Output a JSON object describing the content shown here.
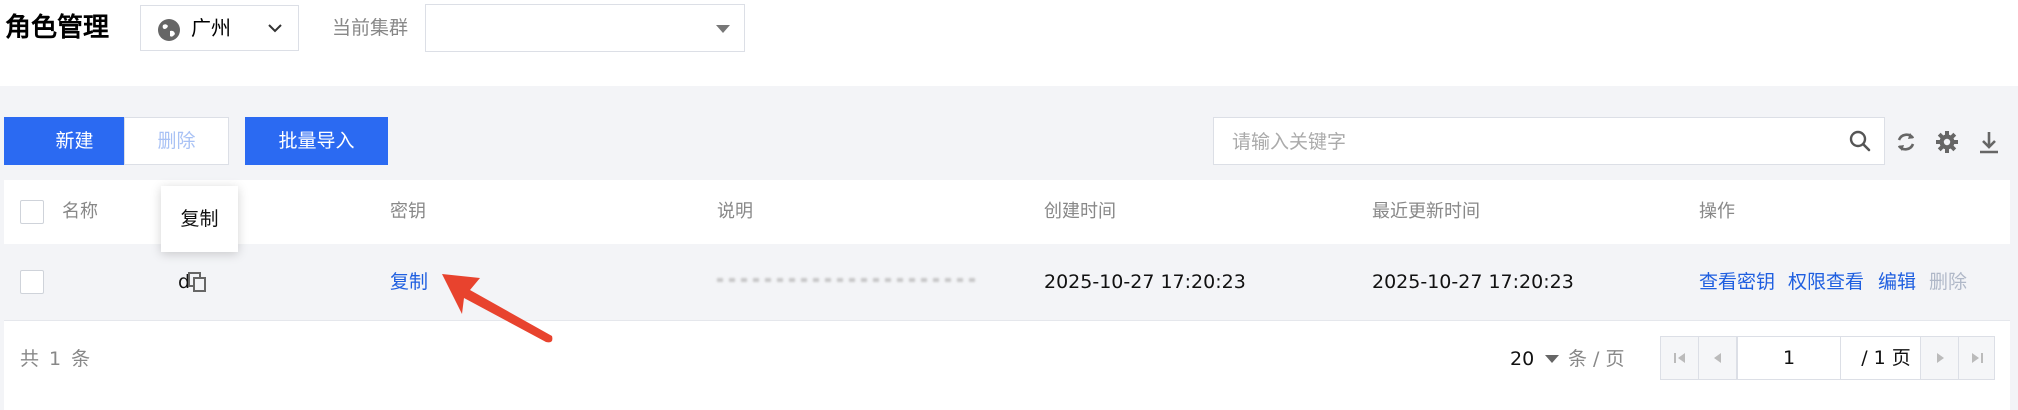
{
  "header": {
    "title": "角色管理",
    "region": "广州",
    "cluster_label": "当前集群",
    "cluster_value": ""
  },
  "toolbar": {
    "new_label": "新建",
    "delete_label": "删除",
    "import_label": "批量导入",
    "search_placeholder": "请输入关键字"
  },
  "table": {
    "columns": [
      "名称",
      "密钥",
      "说明",
      "创建时间",
      "最近更新时间",
      "操作"
    ],
    "rows": [
      {
        "name": "d",
        "key_link": "复制",
        "created": "2025-10-27 17:20:23",
        "updated": "2025-10-27 17:20:23",
        "actions": [
          "查看密钥",
          "权限查看",
          "编辑",
          "删除"
        ]
      }
    ]
  },
  "tooltip": "复制",
  "footer": {
    "total": "共 1 条",
    "page_size": "20",
    "per_page_label": "条 / 页",
    "current_page": "1",
    "total_pages": "/ 1 页"
  },
  "colors": {
    "primary": "#2b6af2",
    "link": "#1f5fe0",
    "arrow": "#e8432e"
  }
}
